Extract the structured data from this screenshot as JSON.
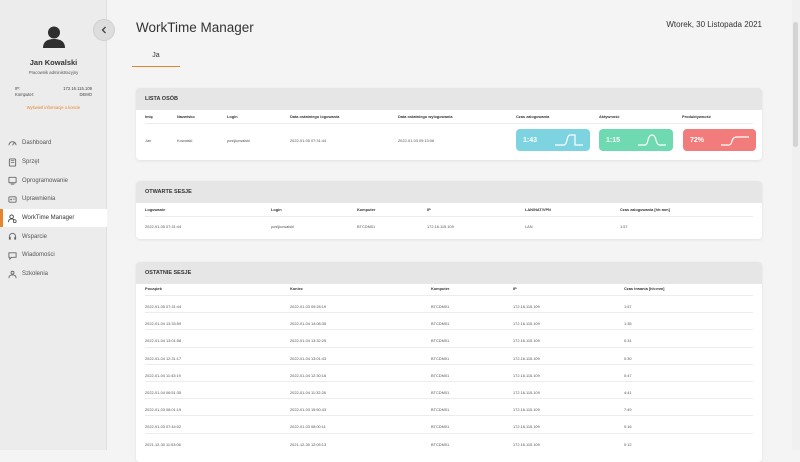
{
  "user": {
    "name": "Jan Kowalski",
    "role": "Pracownik administracyjny",
    "ip_label": "IP:",
    "ip_value": "172.16.115.109",
    "computer_label": "Komputer:",
    "computer_value": "DEMO",
    "more_link": "Wyświetl informacje o koncie"
  },
  "nav": {
    "items": [
      {
        "label": "Dashboard",
        "icon": "dashboard-icon"
      },
      {
        "label": "Sprzęt",
        "icon": "hardware-icon"
      },
      {
        "label": "Oprogramowanie",
        "icon": "software-icon"
      },
      {
        "label": "Uprawnienia",
        "icon": "permissions-icon"
      },
      {
        "label": "WorkTime Manager",
        "icon": "worktime-icon"
      },
      {
        "label": "Wsparcie",
        "icon": "support-icon"
      },
      {
        "label": "Wiadomości",
        "icon": "messages-icon"
      },
      {
        "label": "Szkolenia",
        "icon": "training-icon"
      }
    ],
    "active_index": 4
  },
  "header": {
    "title": "WorkTime Manager",
    "date": "Wtorek, 30 Listopada 2021"
  },
  "tabs": [
    {
      "label": "Ja"
    }
  ],
  "persons": {
    "title": "LISTA OSÓB",
    "headers": [
      "Imię",
      "Nazwisko",
      "Login",
      "Data ostatniego logowania",
      "Data ostatniego wylogowania",
      "Czas zalogowania",
      "Aktywność",
      "Produktywność"
    ],
    "row": [
      "Jan",
      "Kowalski",
      "pos\\jkowalski",
      "2022-01-05 07:31:44",
      "2022-01-03 09:13:06"
    ],
    "stats": [
      {
        "value": "1:43",
        "color": "#7dd3df"
      },
      {
        "value": "1:15",
        "color": "#6fd9b2"
      },
      {
        "value": "72%",
        "color": "#f27c7c"
      }
    ]
  },
  "open_sessions": {
    "title": "OTWARTE SESJE",
    "headers": [
      "Logowanie",
      "Login",
      "Komputer",
      "IP",
      "LAN/NAT/VPN",
      "Czas zalogowania [hh:mm]"
    ],
    "rows": [
      [
        "2022-01-05 07:31:44",
        "pos\\jkowalski",
        "BTCDM01",
        "172.16.115.109",
        "LAN",
        "1:57"
      ]
    ]
  },
  "recent_sessions": {
    "title": "OSTATNIE SESJE",
    "headers": [
      "Początek",
      "Koniec",
      "Komputer",
      "IP",
      "Czas trwania [hh:mm]"
    ],
    "rows": [
      [
        "2022-01-05 07:31:44",
        "2022-01-03 09:28:19",
        "BTCDM01",
        "172.16.115.109",
        "1:57"
      ],
      [
        "2022-01-04 13:33:59",
        "2022-01-04 14:08:35",
        "BTCDM01",
        "172.16.115.109",
        "1:35"
      ],
      [
        "2022-01-04 13:01:58",
        "2022-01-04 13:32:25",
        "BTCDM01",
        "172.16.115.109",
        "0:31"
      ],
      [
        "2022-01-04 12:31:17",
        "2022-01-04 13:01:43",
        "BTCDM01",
        "172.16.115.109",
        "0:30"
      ],
      [
        "2022-01-04 11:43:19",
        "2022-01-04 12:30:16",
        "BTCDM01",
        "172.16.115.109",
        "0:47"
      ],
      [
        "2022-01-04 06:51:35",
        "2022-01-04 11:32:28",
        "BTCDM01",
        "172.16.115.109",
        "4:41"
      ],
      [
        "2022-01-03 08:01:19",
        "2022-01-03 15:50:43",
        "BTCDM01",
        "172.16.115.109",
        "7:49"
      ],
      [
        "2022-01-03 07:44:02",
        "2022-01-03 08:00:11",
        "BTCDM01",
        "172.16.115.109",
        "0:16"
      ],
      [
        "2021-12-30 11:53:06",
        "2021-12-30 12:05:13",
        "BTCDM01",
        "172.16.115.109",
        "0:12"
      ]
    ]
  }
}
